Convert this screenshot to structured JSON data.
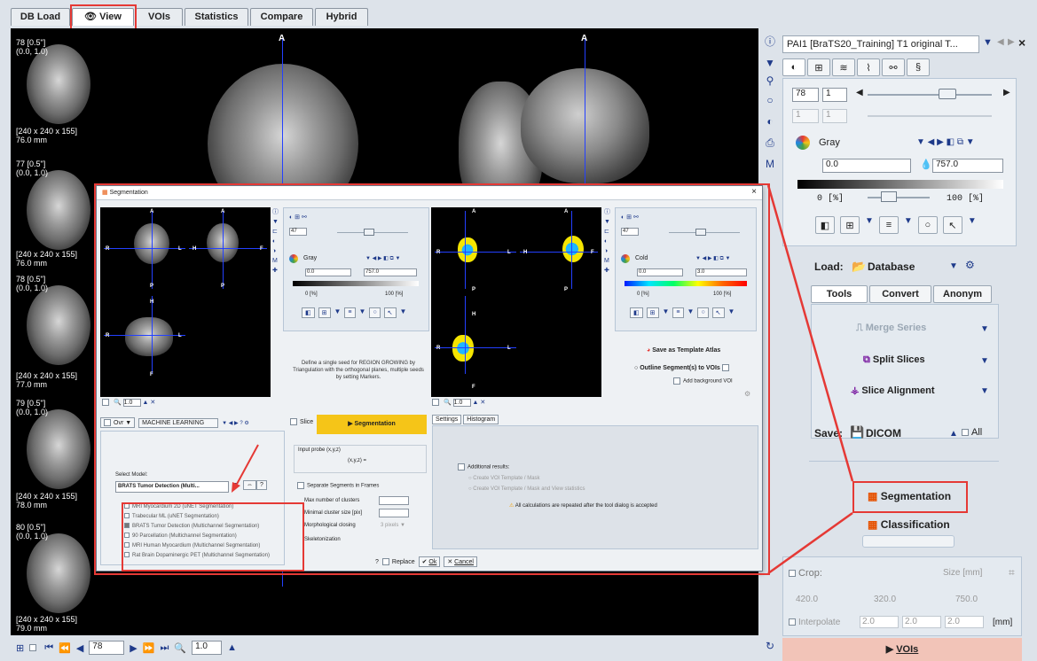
{
  "tabs": [
    {
      "label": "DB Load"
    },
    {
      "label": "View",
      "icon": "eye-icon"
    },
    {
      "label": "VOIs"
    },
    {
      "label": "Statistics"
    },
    {
      "label": "Compare"
    },
    {
      "label": "Hybrid"
    }
  ],
  "thumbs": [
    {
      "top": "78 [0.5\"]",
      "sub": "(0.0, 1.0)",
      "dim": "[240 x 240 x 155]",
      "mm": "76.0 mm"
    },
    {
      "top": "77 [0.5\"]",
      "sub": "(0.0, 1.0)",
      "dim": "[240 x 240 x 155]",
      "mm": "76.0 mm"
    },
    {
      "top": "78 [0.5\"]",
      "sub": "(0.0, 1.0)",
      "dim": "[240 x 240 x 155]",
      "mm": "77.0 mm"
    },
    {
      "top": "79 [0.5\"]",
      "sub": "(0.0, 1.0)",
      "dim": "[240 x 240 x 155]",
      "mm": "78.0 mm"
    },
    {
      "top": "80 [0.5\"]",
      "sub": "(0.0, 1.0)",
      "dim": "[240 x 240 x 155]",
      "mm": "79.0 mm"
    }
  ],
  "viewer": {
    "axis_a": "A",
    "bottom_slice": "78",
    "zoom": "1.0"
  },
  "right": {
    "series_title": "PAI1 [BraTS20_Training] T1 original T...",
    "slice": "78",
    "slice2": "1",
    "dim1": "1",
    "dim2": "1",
    "colortable": "Gray",
    "min": "0.0",
    "max": "757.0",
    "pct_low": "0 [%]",
    "pct_high": "100 [%]",
    "load_label": "Load:",
    "load_source": "Database",
    "subtabs": [
      "Tools",
      "Convert",
      "Anonym"
    ],
    "tools": [
      "Merge Series",
      "Split Slices",
      "Slice Alignment"
    ],
    "save_label": "Save:",
    "save_format": "DICOM",
    "all_label": "All",
    "segmentation": "Segmentation",
    "classification": "Classification",
    "crop": "Crop:",
    "size_mm": "Size [mm]",
    "crop_vals": [
      "420.0",
      "320.0",
      "750.0"
    ],
    "interpolate": "Interpolate",
    "interp_vals": [
      "2.0",
      "2.0",
      "2.0"
    ],
    "mm": "[mm]",
    "vois": "VOIs"
  },
  "dialog": {
    "title": "Segmentation",
    "left": {
      "slice": "47",
      "colortable": "Gray",
      "min": "0.0",
      "max": "757.0",
      "pct_low": "0 [%]",
      "pct_high": "100 [%]",
      "zoom": "1.0"
    },
    "right": {
      "slice": "47",
      "colortable": "Cold",
      "min": "0.0",
      "max": "3.0",
      "pct_low": "0 [%]",
      "pct_high": "100 [%]",
      "zoom": "1.0"
    },
    "labels": {
      "A": "A",
      "P": "P",
      "R": "R",
      "L": "L",
      "H": "H",
      "F": "F"
    },
    "info": "Define a single seed for REGION GROWING by Triangulation with the orthogonal planes, multiple seeds by setting Markers.",
    "save_atlas": "Save as Template Atlas",
    "outline": "Outline Segment(s) to VOIs",
    "add_bg": "Add background VOI",
    "ovr": "Ovr",
    "method": "MACHINE LEARNING",
    "slice_label": "Slice",
    "segment_btn": "Segmentation",
    "settings_tab": "Settings",
    "histogram_tab": "Histogram",
    "input_probe": "Input probe (x,y,z)",
    "xyz": "(x,y,z) =",
    "select_model": "Select Model:",
    "model": "BRATS Tumor Detection (Multi...",
    "models": [
      "MRI Myocardium 2D (uNET Segmentation)",
      "Trabecular ML (uNET Segmentation)",
      "BRATS Tumor Detection (Multichannel Segmentation)",
      "90 Parcellation (Multichannel Segmentation)",
      "MRI Human Myocardium (Multichannel Segmentation)",
      "Rat Brain Dopaminergic PET (Multichannel Segmentation)"
    ],
    "separate": "Separate Segments in Frames",
    "max_clusters": "Max number of clusters",
    "min_cluster": "Minimal cluster size [pix]",
    "morph": "Morphological closing",
    "pixels": "3 pixels",
    "skeleton": "Skeletonization",
    "additional": "Additional results:",
    "create1": "Create VOI Template / Mask",
    "create2": "Create VOI Template / Mask and View statistics",
    "warning": "All calculations are repeated after the tool dialog is accepted",
    "replace": "Replace",
    "ok": "Ok",
    "cancel": "Cancel"
  },
  "colors": {
    "accent_red": "#e53935",
    "seg_yellow": "#f5c518",
    "vois_bar": "#f2c4b8"
  }
}
